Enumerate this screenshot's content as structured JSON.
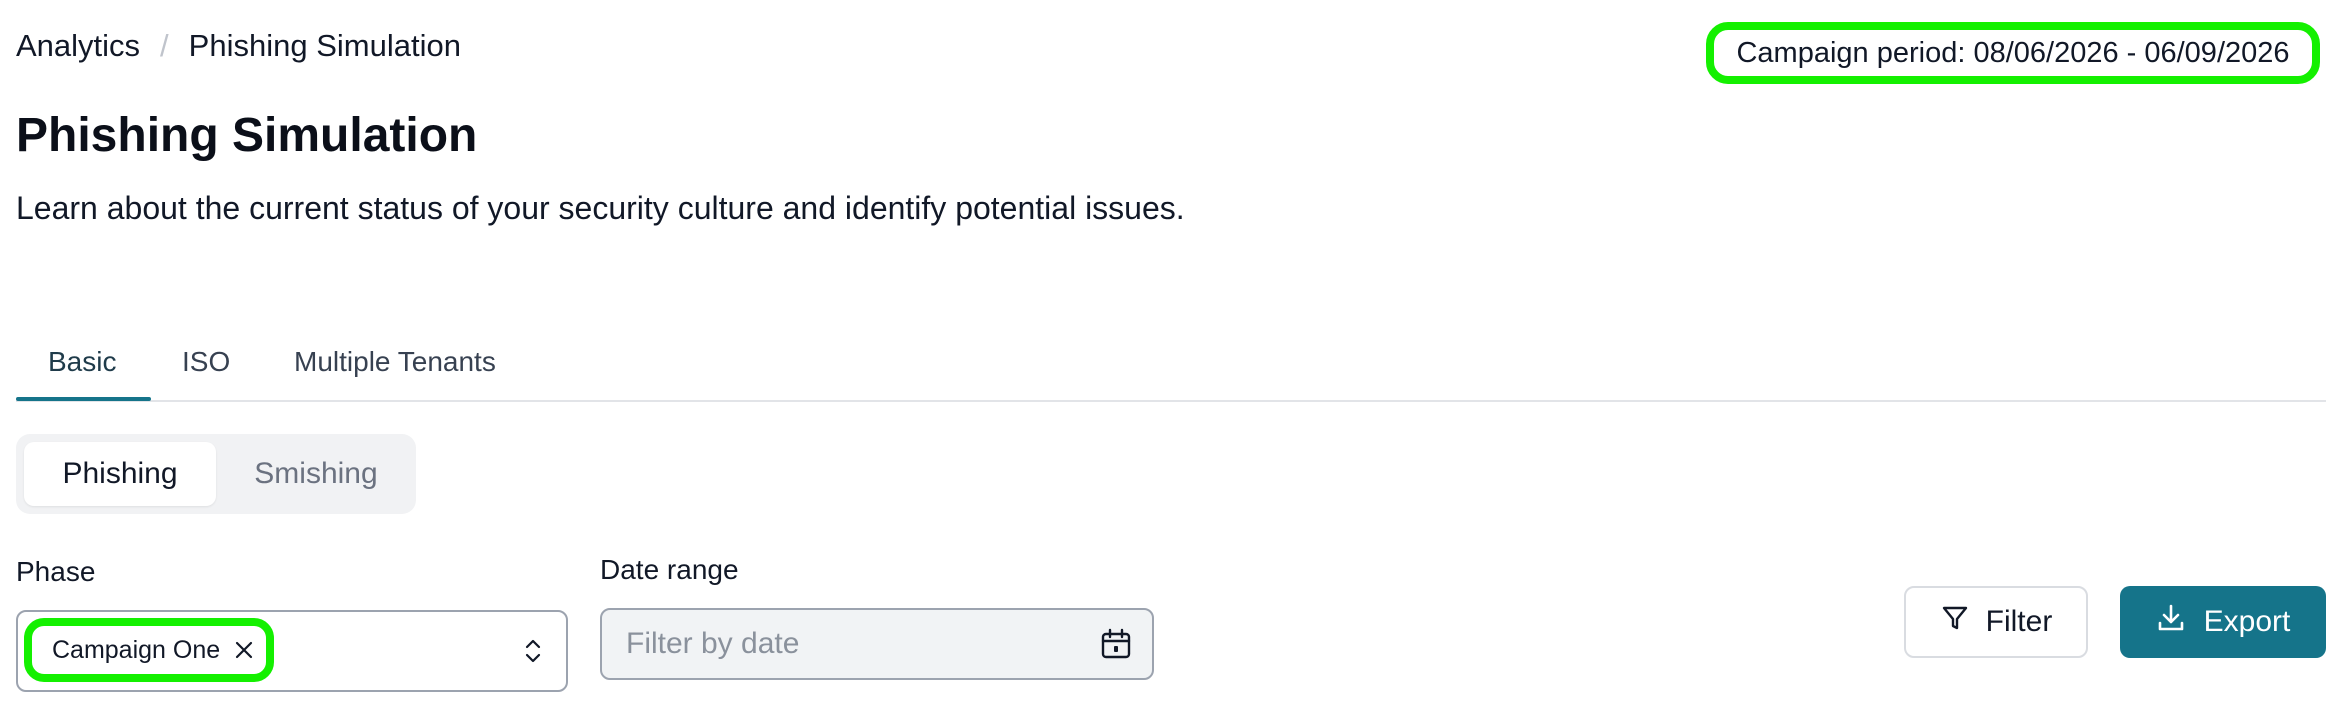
{
  "breadcrumb": {
    "root": "Analytics",
    "separator": "/",
    "current": "Phishing Simulation"
  },
  "campaign_period": "Campaign period: 08/06/2026 - 06/09/2026",
  "page": {
    "title": "Phishing Simulation",
    "subtitle": "Learn about the current status of your security culture and identify potential issues."
  },
  "tabs": [
    {
      "label": "Basic",
      "active": true
    },
    {
      "label": "ISO",
      "active": false
    },
    {
      "label": "Multiple Tenants",
      "active": false
    }
  ],
  "segmented": {
    "options": [
      "Phishing",
      "Smishing"
    ],
    "selected": "Phishing"
  },
  "phase": {
    "label": "Phase",
    "selected_chip": "Campaign One"
  },
  "date_range": {
    "label": "Date range",
    "placeholder": "Filter by date",
    "value": ""
  },
  "actions": {
    "filter_label": "Filter",
    "export_label": "Export"
  },
  "colors": {
    "accent": "#15748a",
    "highlight": "#14f000",
    "text": "#111827",
    "muted": "#6b7280"
  },
  "icons": [
    "close-icon",
    "chevron-up-down-icon",
    "calendar-icon",
    "filter-icon",
    "download-icon"
  ]
}
